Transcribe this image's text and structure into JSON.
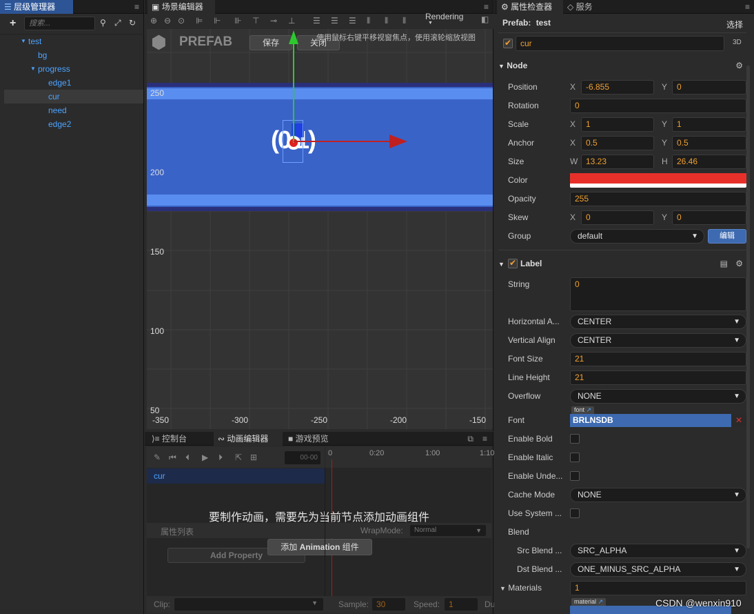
{
  "hierarchy": {
    "tab": "层级管理器",
    "search_placeholder": "搜索...",
    "nodes": [
      "test",
      "bg",
      "progress",
      "edge1",
      "cur",
      "need",
      "edge2"
    ]
  },
  "scene": {
    "tab": "场景编辑器",
    "rendering": "Rendering",
    "prefab_logo": "PREFAB",
    "save": "保存",
    "close": "关闭",
    "hint": "使用鼠标右键平移视窗焦点，使用滚轮缩放视图",
    "y_labels": [
      "250",
      "200",
      "150",
      "100",
      "50"
    ],
    "x_labels": [
      "-350",
      "-300",
      "-250",
      "-200",
      "-150"
    ],
    "label_text": "(0/1)"
  },
  "anim": {
    "tabs": [
      "控制台",
      "动画编辑器",
      "游戏预览"
    ],
    "time": "00-00",
    "ticks": [
      "0",
      "0:20",
      "1:00",
      "1:10"
    ],
    "node": "cur",
    "message": "要制作动画，需要先为当前节点添加动画组件",
    "prop_list": "属性列表",
    "wrap_mode_label": "WrapMode:",
    "wrap_mode": "Normal",
    "add_property": "Add Property",
    "add_anim_btn_prefix": "添加",
    "add_anim_btn_bold": "Animation",
    "add_anim_btn_suffix": "组件",
    "clip_label": "Clip:",
    "sample_label": "Sample:",
    "sample": "30",
    "speed_label": "Speed:",
    "speed": "1",
    "dur_label": "Du"
  },
  "inspector": {
    "tab1": "属性检查器",
    "tab2": "服务",
    "prefab_label": "Prefab:",
    "prefab_name": "test",
    "select": "选择",
    "node_name": "cur",
    "three_d": "3D",
    "node_section": "Node",
    "position": {
      "label": "Position",
      "x": "-6.855",
      "y": "0"
    },
    "rotation": {
      "label": "Rotation",
      "v": "0"
    },
    "scale": {
      "label": "Scale",
      "x": "1",
      "y": "1"
    },
    "anchor": {
      "label": "Anchor",
      "x": "0.5",
      "y": "0.5"
    },
    "size": {
      "label": "Size",
      "w": "13.23",
      "h": "26.46"
    },
    "color": {
      "label": "Color",
      "value": "#e8302a"
    },
    "opacity": {
      "label": "Opacity",
      "v": "255"
    },
    "skew": {
      "label": "Skew",
      "x": "0",
      "y": "0"
    },
    "group": {
      "label": "Group",
      "v": "default",
      "edit": "编辑"
    },
    "label_section": "Label",
    "string": {
      "label": "String",
      "v": "0"
    },
    "halign": {
      "label": "Horizontal A...",
      "v": "CENTER"
    },
    "valign": {
      "label": "Vertical Align",
      "v": "CENTER"
    },
    "font_size": {
      "label": "Font Size",
      "v": "21"
    },
    "line_height": {
      "label": "Line Height",
      "v": "21"
    },
    "overflow": {
      "label": "Overflow",
      "v": "NONE"
    },
    "font": {
      "label": "Font",
      "tag": "font",
      "v": "BRLNSDB"
    },
    "enable_bold": "Enable Bold",
    "enable_italic": "Enable Italic",
    "enable_underline": "Enable Unde...",
    "cache_mode": {
      "label": "Cache Mode",
      "v": "NONE"
    },
    "use_system": "Use System ...",
    "blend": "Blend",
    "src_blend": {
      "label": "Src Blend ...",
      "v": "SRC_ALPHA"
    },
    "dst_blend": {
      "label": "Dst Blend ...",
      "v": "ONE_MINUS_SRC_ALPHA"
    },
    "materials": {
      "label": "Materials",
      "v": "1",
      "tag": "material"
    },
    "watermark": "CSDN @wenxin910"
  }
}
